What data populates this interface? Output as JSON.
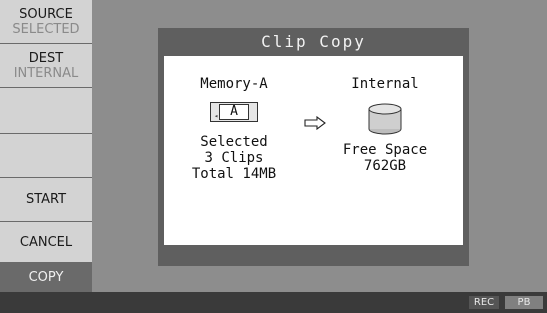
{
  "sidebar": {
    "source": {
      "label": "SOURCE",
      "value": "SELECTED"
    },
    "dest": {
      "label": "DEST",
      "value": "INTERNAL"
    },
    "start_label": "START",
    "cancel_label": "CANCEL",
    "copy_label": "COPY"
  },
  "dialog": {
    "title": "Clip Copy",
    "source": {
      "title": "Memory-A",
      "card_letter": "A",
      "line1": "Selected",
      "line2": "3 Clips",
      "line3": "Total 14MB",
      "icon": "memory-card-icon"
    },
    "arrow_icon": "right-arrow-icon",
    "destination": {
      "title": "Internal",
      "line1": "Free Space",
      "line2": "762GB",
      "icon": "disk-drive-icon"
    }
  },
  "statusbar": {
    "rec_label": "REC",
    "pb_label": "PB"
  }
}
